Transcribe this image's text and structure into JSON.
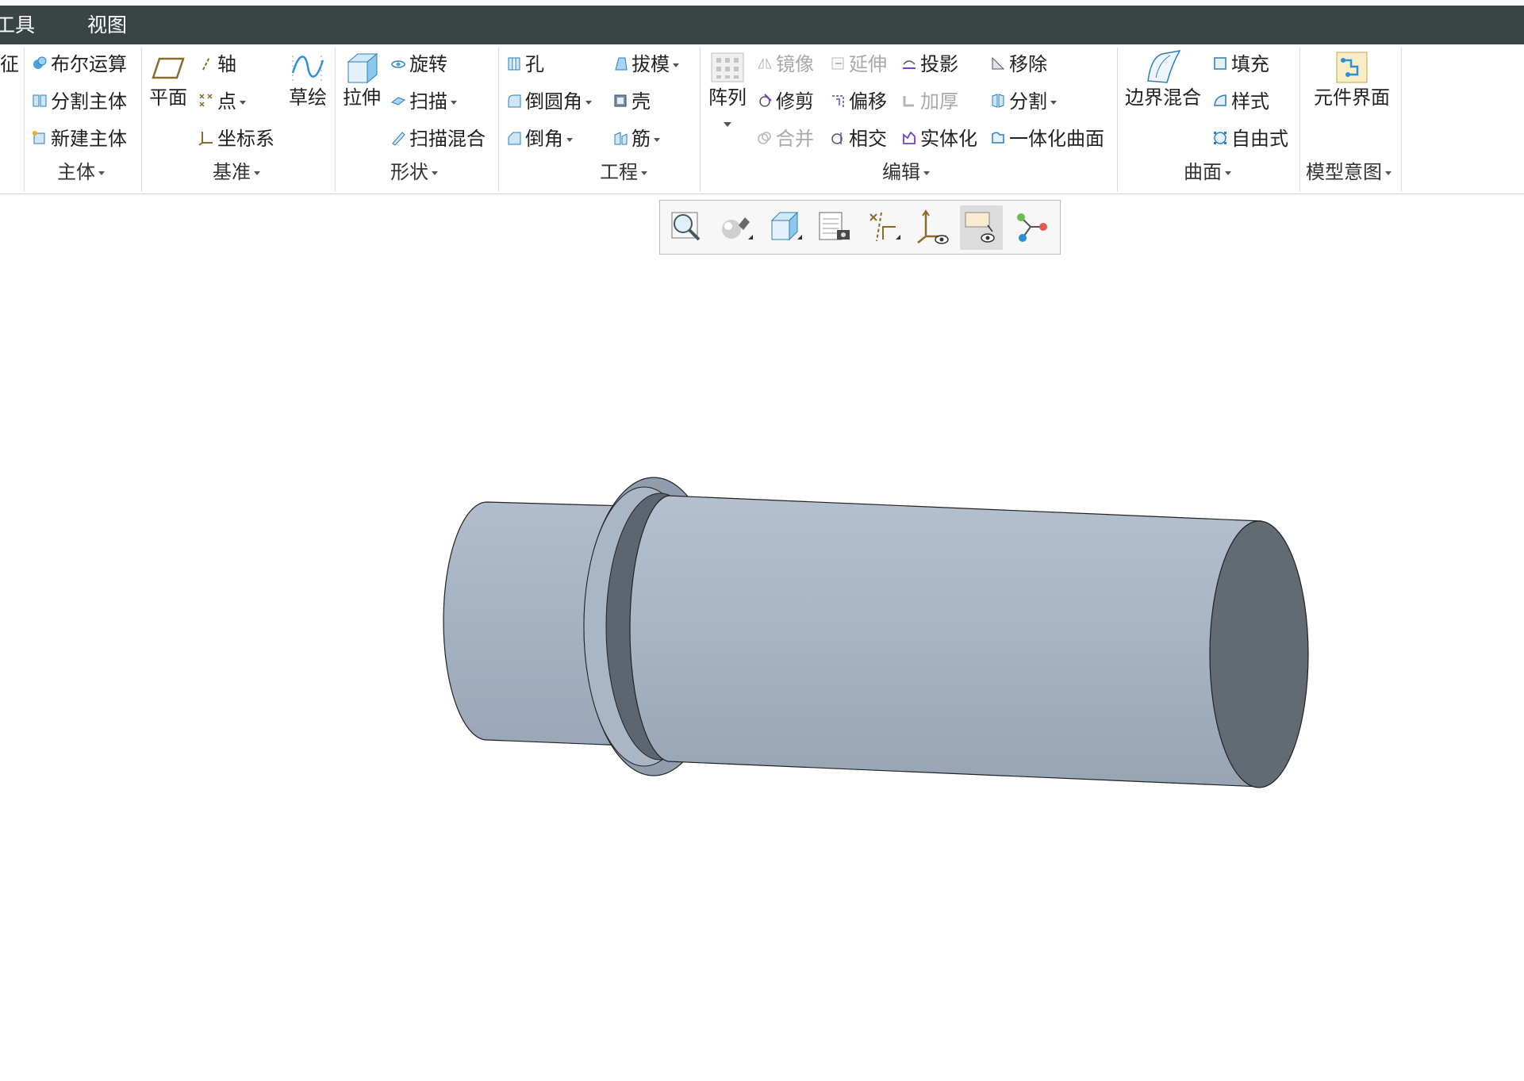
{
  "menu": {
    "tools": "工具",
    "view": "视图"
  },
  "groups": {
    "body": {
      "label": "主体",
      "cut_label": "征",
      "items": {
        "boolean": "布尔运算",
        "split_body": "分割主体",
        "new_body": "新建主体"
      }
    },
    "datum": {
      "label": "基准",
      "plane": "平面",
      "axis": "轴",
      "point": "点",
      "csys": "坐标系",
      "sketch": "草绘"
    },
    "shape": {
      "label": "形状",
      "extrude": "拉伸",
      "revolve": "旋转",
      "sweep": "扫描",
      "swept_blend": "扫描混合"
    },
    "engineering": {
      "label": "工程",
      "hole": "孔",
      "round": "倒圆角",
      "chamfer": "倒角",
      "draft": "拔模",
      "shell": "壳",
      "rib": "筋"
    },
    "editing": {
      "label": "编辑",
      "pattern": "阵列",
      "mirror": "镜像",
      "trim": "修剪",
      "merge": "合并",
      "extend": "延伸",
      "offset": "偏移",
      "intersect": "相交",
      "project": "投影",
      "thicken": "加厚",
      "solidify": "实体化",
      "remove": "移除",
      "split": "分割",
      "unify_surface": "一体化曲面"
    },
    "surfaces": {
      "label": "曲面",
      "boundary_blend": "边界混合",
      "fill": "填充",
      "style": "样式",
      "freestyle": "自由式"
    },
    "model_intent": {
      "label": "模型意图",
      "component_interface": "元件界面"
    }
  },
  "view_toolbar": [
    "refit-zoom-icon",
    "display-style-icon",
    "saved-orientations-icon",
    "view-manager-icon",
    "datum-display-filters-icon",
    "csys-display-icon",
    "annotation-display-icon",
    "spin-center-icon"
  ],
  "model": {
    "surface_color": "#a9b6c6",
    "end_face_color": "#626a74"
  },
  "colors": {
    "menubar": "#3b4445",
    "datum_icon": "#8b6a2a",
    "accent": "#2b8fd6"
  }
}
